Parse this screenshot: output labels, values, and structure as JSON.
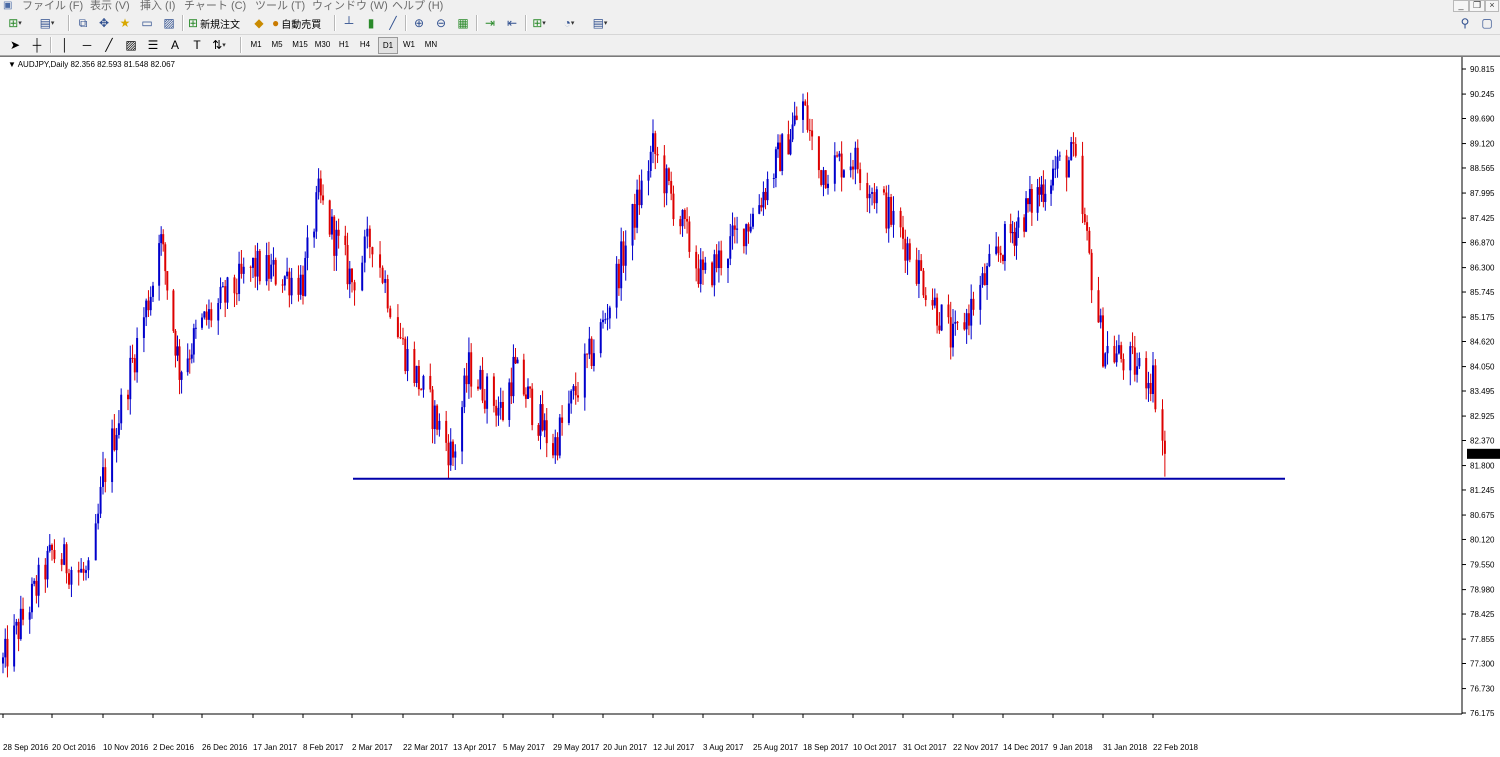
{
  "menubar": {
    "items": [
      "ファイル (F)",
      "表示 (V)",
      "挿入 (I)",
      "チャート (C)",
      "ツール (T)",
      "ウィンドウ (W)",
      "ヘルプ (H)"
    ]
  },
  "toolbar": {
    "new_order_label": "新規注文",
    "auto_trading_label": "自動売買",
    "timeframes": [
      "M1",
      "M5",
      "M15",
      "M30",
      "H1",
      "H4",
      "D1",
      "W1",
      "MN"
    ],
    "active_timeframe": "D1"
  },
  "chart": {
    "symbol_info": "AUDJPY,Daily  82.356 82.593 81.548 82.067",
    "current_price_label": "82.067",
    "bull_color": "#0000cc",
    "bear_color": "#dd0000",
    "hline_color": "#0000aa"
  },
  "chart_data": {
    "type": "candlestick",
    "symbol": "AUDJPY",
    "timeframe": "Daily",
    "ohlc_last": {
      "open": 82.356,
      "high": 82.593,
      "low": 81.548,
      "close": 82.067
    },
    "y_ticks": [
      "90.815",
      "90.245",
      "89.690",
      "89.120",
      "88.565",
      "87.995",
      "87.425",
      "86.870",
      "86.300",
      "85.745",
      "85.175",
      "84.620",
      "84.050",
      "83.495",
      "82.925",
      "82.370",
      "81.800",
      "81.245",
      "80.675",
      "80.120",
      "79.550",
      "78.980",
      "78.425",
      "77.855",
      "77.300",
      "76.730",
      "76.175"
    ],
    "x_ticks": [
      "28 Sep 2016",
      "20 Oct 2016",
      "10 Nov 2016",
      "2 Dec 2016",
      "26 Dec 2016",
      "17 Jan 2017",
      "8 Feb 2017",
      "2 Mar 2017",
      "22 Mar 2017",
      "13 Apr 2017",
      "5 May 2017",
      "29 May 2017",
      "20 Jun 2017",
      "12 Jul 2017",
      "3 Aug 2017",
      "25 Aug 2017",
      "18 Sep 2017",
      "10 Oct 2017",
      "31 Oct 2017",
      "22 Nov 2017",
      "14 Dec 2017",
      "9 Jan 2018",
      "31 Jan 2018",
      "22 Feb 2018"
    ],
    "ylim": [
      76.0,
      91.0
    ],
    "horizontal_line": 81.5,
    "horizontal_line_range": [
      "2 Mar 2017",
      "after 22 Feb 2018"
    ],
    "price_path": [
      [
        "28 Sep 2016",
        77.3
      ],
      [
        "20 Oct 2016",
        79.8
      ],
      [
        "5 Nov 2016",
        79.2
      ],
      [
        "10 Nov 2016",
        81.5
      ],
      [
        "2 Dec 2016",
        86.0
      ],
      [
        "5 Dec 2016",
        87.2
      ],
      [
        "15 Dec 2016",
        84.0
      ],
      [
        "26 Dec 2016",
        85.0
      ],
      [
        "17 Jan 2017",
        86.3
      ],
      [
        "8 Feb 2017",
        86.0
      ],
      [
        "15 Feb 2017",
        87.9
      ],
      [
        "2 Mar 2017",
        86.0
      ],
      [
        "10 Mar 2017",
        87.0
      ],
      [
        "22 Mar 2017",
        84.5
      ],
      [
        "13 Apr 2017",
        82.0
      ],
      [
        "20 Apr 2017",
        84.0
      ],
      [
        "5 May 2017",
        83.0
      ],
      [
        "10 May 2017",
        84.0
      ],
      [
        "29 May 2017",
        82.2
      ],
      [
        "20 Jun 2017",
        85.0
      ],
      [
        "12 Jul 2017",
        89.0
      ],
      [
        "3 Aug 2017",
        86.0
      ],
      [
        "25 Aug 2017",
        87.5
      ],
      [
        "18 Sep 2017",
        90.0
      ],
      [
        "25 Sep 2017",
        88.5
      ],
      [
        "10 Oct 2017",
        88.8
      ],
      [
        "31 Oct 2017",
        87.0
      ],
      [
        "22 Nov 2017",
        84.6
      ],
      [
        "14 Dec 2017",
        86.8
      ],
      [
        "9 Jan 2018",
        88.5
      ],
      [
        "18 Jan 2018",
        88.8
      ],
      [
        "31 Jan 2018",
        84.5
      ],
      [
        "22 Feb 2018",
        83.8
      ],
      [
        "27 Feb 2018",
        82.07
      ]
    ]
  }
}
